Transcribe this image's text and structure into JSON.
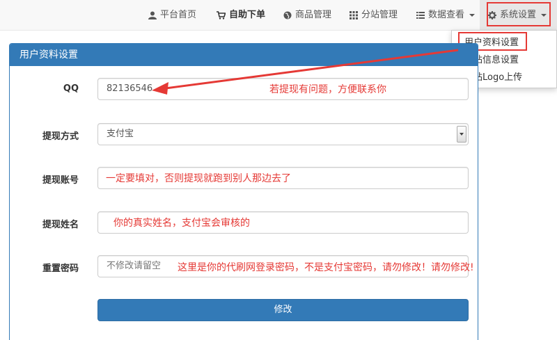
{
  "nav": {
    "items": [
      {
        "label": "平台首页",
        "icon": "user-icon"
      },
      {
        "label": "自助下单",
        "icon": "cart-icon"
      },
      {
        "label": "商品管理",
        "icon": "globe-icon"
      },
      {
        "label": "分站管理",
        "icon": "grid-icon"
      },
      {
        "label": "数据查看",
        "icon": "list-icon"
      },
      {
        "label": "系统设置",
        "icon": "gear-icon"
      }
    ]
  },
  "dropdown": {
    "items": [
      "用户资料设置",
      "网站信息设置",
      "网站Logo上传"
    ]
  },
  "panel": {
    "title": "用户资料设置"
  },
  "form": {
    "qq": {
      "label": "QQ",
      "value": "82136546"
    },
    "method": {
      "label": "提现方式",
      "value": "支付宝"
    },
    "account": {
      "label": "提现账号",
      "value": ""
    },
    "name": {
      "label": "提现姓名",
      "value": ""
    },
    "password": {
      "label": "重置密码",
      "placeholder": "不修改请留空"
    },
    "submit_label": "修改"
  },
  "notes": {
    "qq": "若提现有问题，方便联系你",
    "account": "一定要填对，否则提现就跑到别人那边去了",
    "name": "你的真实姓名，支付宝会审核的",
    "password": "这里是你的代刷网登录密码，不是支付宝密码，请勿修改！请勿修改!"
  },
  "colors": {
    "primary": "#337ab7",
    "annotation": "#e53935"
  }
}
